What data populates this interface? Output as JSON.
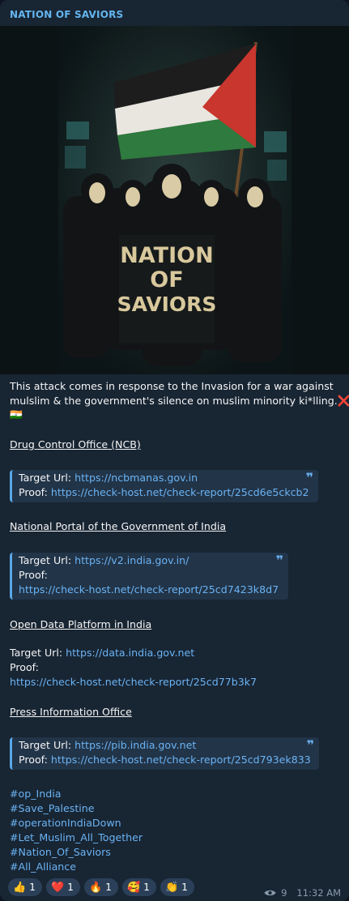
{
  "channel": {
    "name": "NATION OF SAVIORS"
  },
  "photo": {
    "banner_line1": "NATION",
    "banner_line2": "OF",
    "banner_line3": "SAVIORS"
  },
  "message": {
    "intro_line1": "This attack comes in response to the Invasion for a war against",
    "intro_line2": "mulslim & the government's silence on muslim minority ki*lling.",
    "cross_emoji": "❌",
    "flag_emoji": "🇮🇳",
    "targets": [
      {
        "title": "Drug Control Office (NCB)",
        "url_label": "Target Url: ",
        "url": "https://ncbmanas.gov.in",
        "proof_label": "Proof: ",
        "proof": "https://check-host.net/check-report/25cd6e5ckcb2"
      },
      {
        "title": "National Portal of the Government of India",
        "url_label": "Target Url: ",
        "url": "https://v2.india.gov.in/",
        "proof_label": "Proof:",
        "proof": "https://check-host.net/check-report/25cd7423k8d7"
      },
      {
        "title": "Open Data Platform in India",
        "url_label": "Target Url: ",
        "url": "https://data.india.gov.net",
        "proof_label": "Proof:",
        "proof": "https://check-host.net/check-report/25cd77b3k7"
      },
      {
        "title": "Press Information Office",
        "url_label": "Target Url: ",
        "url": "https://pib.india.gov.net",
        "proof_label": "Proof: ",
        "proof": "https://check-host.net/check-report/25cd793ek833"
      }
    ],
    "hashtags": [
      "#op_India",
      "#Save_Palestine",
      "#operationIndiaDown",
      "#Let_Muslim_All_Together",
      "#Nation_Of_Saviors",
      "#All_Alliance"
    ]
  },
  "reactions": [
    {
      "emoji": "👍",
      "count": "1"
    },
    {
      "emoji": "❤️",
      "count": "1"
    },
    {
      "emoji": "🔥",
      "count": "1"
    },
    {
      "emoji": "🥰",
      "count": "1"
    },
    {
      "emoji": "👏",
      "count": "1"
    }
  ],
  "meta": {
    "views": "9",
    "time": "11:32 AM"
  },
  "colors": {
    "background": "#0e1621",
    "bubble": "#182533",
    "link": "#6ab3f3",
    "channel_name": "#64b5ef"
  }
}
